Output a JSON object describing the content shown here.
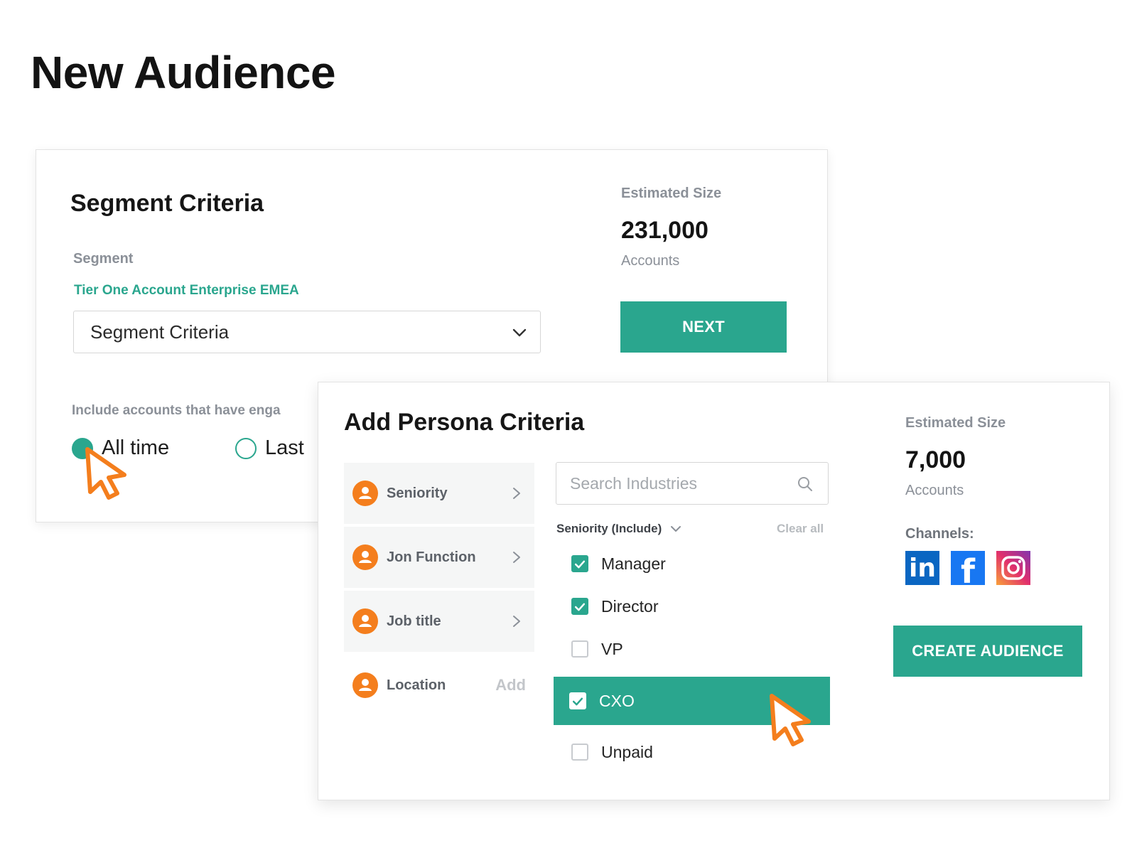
{
  "page": {
    "title": "New Audience"
  },
  "segment_card": {
    "title": "Segment Criteria",
    "segment_label": "Segment",
    "segment_name": "Tier One Account Enterprise EMEA",
    "select_value": "Segment Criteria",
    "include_label": "Include accounts that have enga",
    "radio_options": [
      {
        "label": "All time",
        "checked": true
      },
      {
        "label": "Last",
        "checked": false
      }
    ],
    "estimated": {
      "label": "Estimated Size",
      "value": "231,000",
      "unit": "Accounts"
    },
    "next_label": "NEXT"
  },
  "persona_card": {
    "title": "Add Persona Criteria",
    "criteria": [
      {
        "label": "Seniority",
        "action": "chevron"
      },
      {
        "label": "Jon Function",
        "action": "chevron"
      },
      {
        "label": "Job title",
        "action": "chevron"
      },
      {
        "label": "Location",
        "action": "Add"
      }
    ],
    "search_placeholder": "Search Industries",
    "filter_heading": "Seniority (Include)",
    "clear_all": "Clear all",
    "options": [
      {
        "label": "Manager",
        "checked": true
      },
      {
        "label": "Director",
        "checked": true
      },
      {
        "label": "VP",
        "checked": false
      },
      {
        "label": "CXO",
        "checked": true,
        "highlighted": true
      },
      {
        "label": "Unpaid",
        "checked": false
      }
    ],
    "estimated": {
      "label": "Estimated Size",
      "value": "7,000",
      "unit": "Accounts"
    },
    "channels_label": "Channels:",
    "channels": [
      {
        "name": "linkedin-icon",
        "text": "in",
        "color": "#0a66c2"
      },
      {
        "name": "facebook-icon",
        "text": "f",
        "color": "#1877f2"
      },
      {
        "name": "instagram-icon",
        "text": "",
        "color": "#e1306c"
      }
    ],
    "create_label": "CREATE AUDIENCE"
  },
  "colors": {
    "accent": "#2aa68e",
    "cursor": "#f47e1d",
    "muted": "#8b9098"
  }
}
